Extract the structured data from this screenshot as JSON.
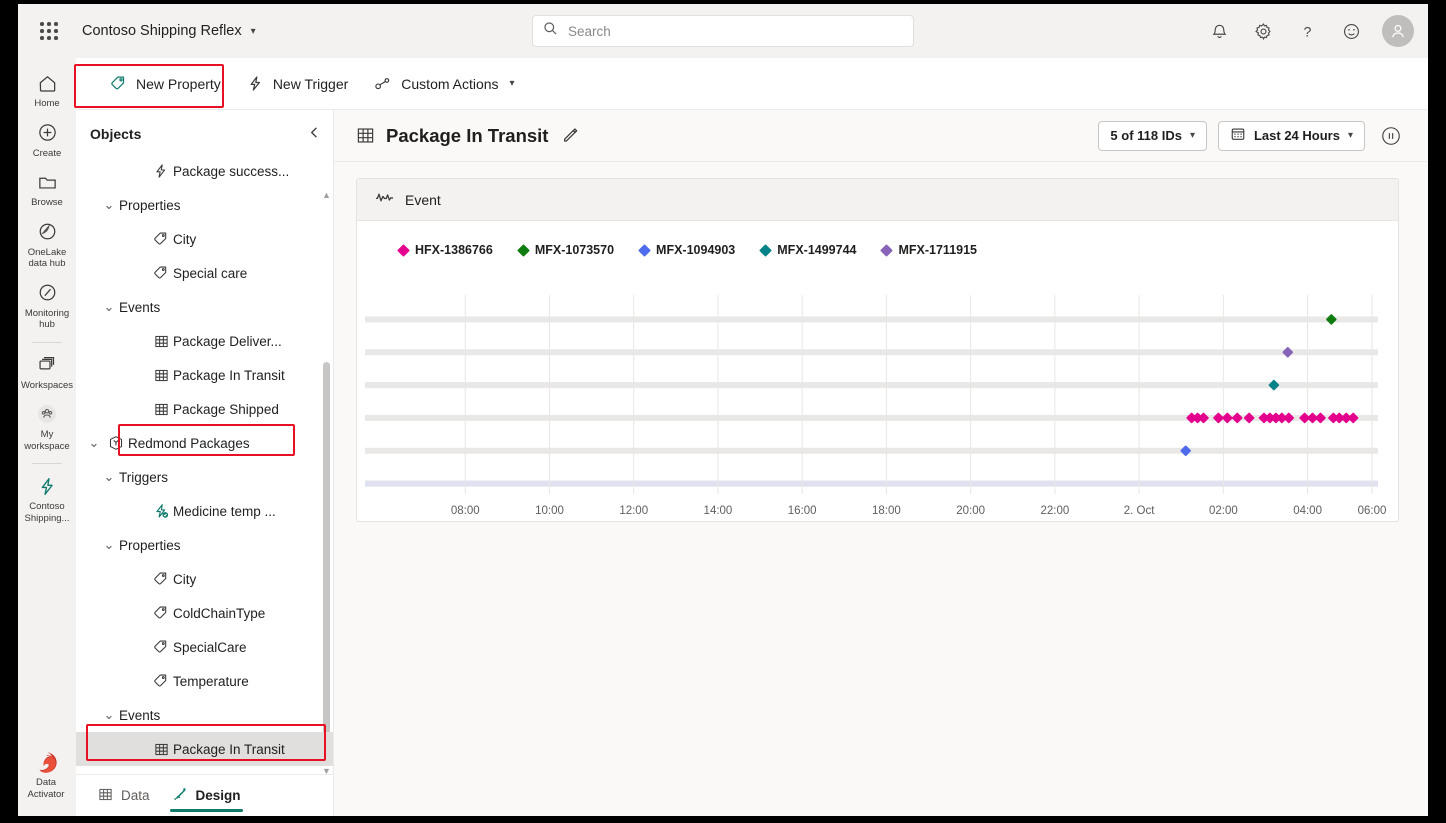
{
  "topbar": {
    "waffle_label": "app-launcher",
    "app_title": "Contoso Shipping Reflex",
    "search_placeholder": "Search",
    "search_value": "",
    "icons": [
      "notifications-icon",
      "settings-icon",
      "help-icon",
      "feedback-icon",
      "account-icon"
    ]
  },
  "rail": {
    "items": [
      {
        "label": "Home",
        "icon": "home-icon"
      },
      {
        "label": "Create",
        "icon": "plus-circle-icon"
      },
      {
        "label": "Browse",
        "icon": "folder-icon"
      },
      {
        "label": "OneLake data hub",
        "icon": "onelake-icon"
      },
      {
        "label": "Monitoring hub",
        "icon": "monitoring-icon"
      },
      {
        "label": "Workspaces",
        "icon": "workspaces-icon"
      },
      {
        "label": "My workspace",
        "icon": "my-workspace-icon"
      },
      {
        "label": "Contoso Shipping...",
        "icon": "reflex-bolt-icon"
      }
    ],
    "bottom": {
      "label": "Data Activator",
      "icon": "data-activator-icon"
    }
  },
  "commandbar": {
    "buttons": [
      {
        "label": "New Property",
        "icon": "tag-icon",
        "chevron": false,
        "highlighted": true
      },
      {
        "label": "New Trigger",
        "icon": "bolt-icon",
        "chevron": false,
        "highlighted": false
      },
      {
        "label": "Custom Actions",
        "icon": "actions-icon",
        "chevron": true,
        "highlighted": false
      }
    ]
  },
  "objects": {
    "title": "Objects",
    "collapse_icon": "chevron-left-icon",
    "tree": [
      {
        "label": "Package success...",
        "icon": "bolt-icon",
        "indent": 3,
        "twisty": "",
        "type": "trigger",
        "selected": false
      },
      {
        "label": "Properties",
        "icon": "",
        "indent": 1,
        "twisty": "v",
        "type": "group",
        "selected": false
      },
      {
        "label": "City",
        "icon": "tag-icon",
        "indent": 3,
        "twisty": "",
        "type": "property",
        "selected": false
      },
      {
        "label": "Special care",
        "icon": "tag-icon",
        "indent": 3,
        "twisty": "",
        "type": "property",
        "selected": false
      },
      {
        "label": "Events",
        "icon": "",
        "indent": 1,
        "twisty": "v",
        "type": "group",
        "selected": false
      },
      {
        "label": "Package Deliver...",
        "icon": "grid-icon",
        "indent": 3,
        "twisty": "",
        "type": "event",
        "selected": false
      },
      {
        "label": "Package In Transit",
        "icon": "grid-icon",
        "indent": 3,
        "twisty": "",
        "type": "event",
        "selected": false
      },
      {
        "label": "Package Shipped",
        "icon": "grid-icon",
        "indent": 3,
        "twisty": "",
        "type": "event",
        "selected": false
      },
      {
        "label": "Redmond Packages",
        "icon": "object-icon",
        "indent": 0,
        "twisty": "v",
        "type": "object",
        "selected": false
      },
      {
        "label": "Triggers",
        "icon": "",
        "indent": 1,
        "twisty": "v",
        "type": "group",
        "selected": false
      },
      {
        "label": "Medicine temp ...",
        "icon": "trigger-active-icon",
        "indent": 3,
        "twisty": "",
        "type": "trigger",
        "selected": false
      },
      {
        "label": "Properties",
        "icon": "",
        "indent": 1,
        "twisty": "v",
        "type": "group",
        "selected": false
      },
      {
        "label": "City",
        "icon": "tag-icon",
        "indent": 3,
        "twisty": "",
        "type": "property",
        "selected": false
      },
      {
        "label": "ColdChainType",
        "icon": "tag-icon",
        "indent": 3,
        "twisty": "",
        "type": "property",
        "selected": false
      },
      {
        "label": "SpecialCare",
        "icon": "tag-icon",
        "indent": 3,
        "twisty": "",
        "type": "property",
        "selected": false
      },
      {
        "label": "Temperature",
        "icon": "tag-icon",
        "indent": 3,
        "twisty": "",
        "type": "property",
        "selected": false
      },
      {
        "label": "Events",
        "icon": "",
        "indent": 1,
        "twisty": "v",
        "type": "group",
        "selected": false
      },
      {
        "label": "Package In Transit",
        "icon": "grid-icon",
        "indent": 3,
        "twisty": "",
        "type": "event",
        "selected": true
      }
    ],
    "tabs": [
      {
        "label": "Data",
        "icon": "grid-icon",
        "active": false
      },
      {
        "label": "Design",
        "icon": "design-pen-icon",
        "active": true
      }
    ]
  },
  "canvas": {
    "title": "Package In Transit",
    "title_icon": "grid-icon",
    "edit_icon": "pencil-icon",
    "ids_pill": "5 of 118 IDs",
    "time_pill": "Last 24 Hours",
    "time_pill_icon": "calendar-icon",
    "pause_icon": "pause-icon"
  },
  "chart_data": {
    "type": "scatter",
    "title": "Event",
    "title_icon": "activity-line-icon",
    "xlabel": "",
    "ylabel": "",
    "grid": true,
    "legend_position": "top-left",
    "x_ticks": [
      "08:00",
      "10:00",
      "12:00",
      "14:00",
      "16:00",
      "18:00",
      "20:00",
      "22:00",
      "2. Oct",
      "02:00",
      "04:00",
      "06:00"
    ],
    "x_tick_positions": [
      0.085,
      0.17,
      0.255,
      0.34,
      0.425,
      0.51,
      0.595,
      0.68,
      0.765,
      0.85,
      0.935,
      1.0
    ],
    "y_lanes": [
      {
        "name": "MFX-1073570",
        "color": "#107c10",
        "row": 1
      },
      {
        "name": "MFX-1711915",
        "color": "#8764b8",
        "row": 2
      },
      {
        "name": "MFX-1499744",
        "color": "#038387",
        "row": 3
      },
      {
        "name": "HFX-1386766",
        "color": "#e3008c",
        "row": 4
      },
      {
        "name": "MFX-1094903",
        "color": "#4f6bed",
        "row": 5
      }
    ],
    "series": [
      {
        "name": "HFX-1386766",
        "color": "#e3008c",
        "lane": 4,
        "x": [
          0.818,
          0.824,
          0.83,
          0.845,
          0.854,
          0.864,
          0.876,
          0.891,
          0.897,
          0.903,
          0.909,
          0.916,
          0.932,
          0.94,
          0.948,
          0.961,
          0.967,
          0.974,
          0.981
        ]
      },
      {
        "name": "MFX-1073570",
        "color": "#107c10",
        "lane": 1,
        "x": [
          0.959
        ]
      },
      {
        "name": "MFX-1094903",
        "color": "#4f6bed",
        "lane": 5,
        "x": [
          0.812
        ]
      },
      {
        "name": "MFX-1499744",
        "color": "#038387",
        "lane": 3,
        "x": [
          0.901
        ]
      },
      {
        "name": "MFX-1711915",
        "color": "#8764b8",
        "lane": 2,
        "x": [
          0.915
        ]
      }
    ],
    "legend": [
      {
        "label": "HFX-1386766",
        "color": "#e3008c"
      },
      {
        "label": "MFX-1073570",
        "color": "#107c10"
      },
      {
        "label": "MFX-1094903",
        "color": "#4f6bed"
      },
      {
        "label": "MFX-1499744",
        "color": "#038387"
      },
      {
        "label": "MFX-1711915",
        "color": "#8764b8"
      }
    ]
  },
  "highlights": {
    "accent": "#e81123",
    "brand": "#0f7b6c"
  }
}
